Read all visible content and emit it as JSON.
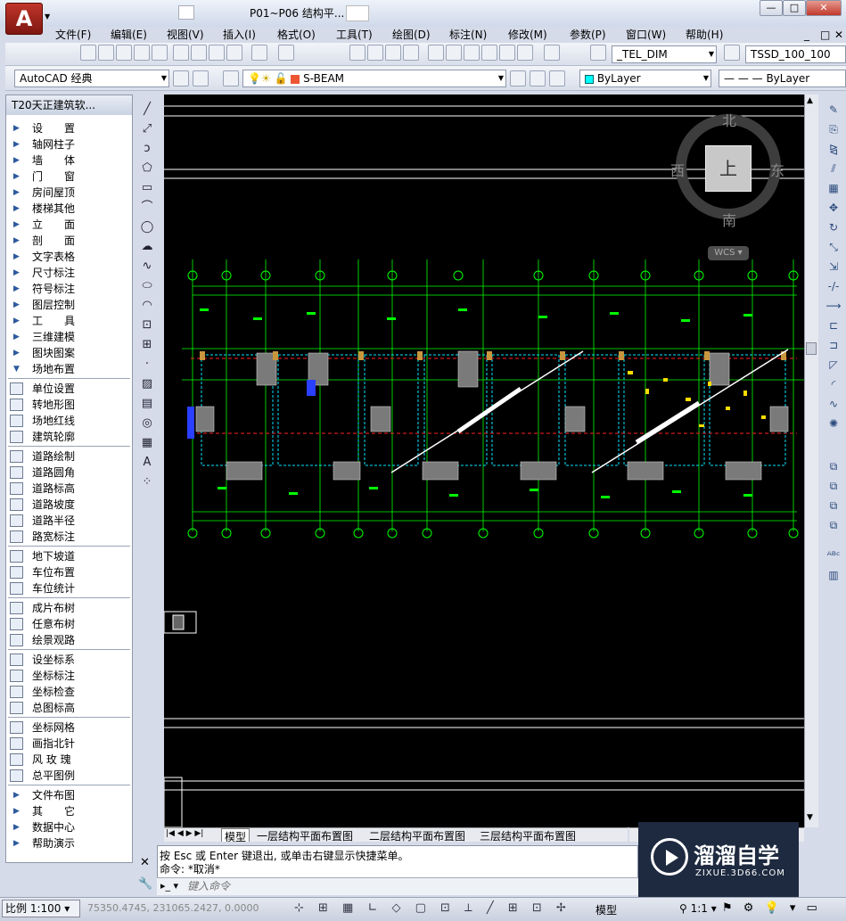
{
  "window": {
    "title": "P01~P06 结构平...",
    "logo_letter": "A",
    "controls": [
      "—",
      "□",
      "✕"
    ]
  },
  "menubar": {
    "items": [
      "文件(F)",
      "编辑(E)",
      "视图(V)",
      "插入(I)",
      "格式(O)",
      "工具(T)",
      "绘图(D)",
      "标注(N)",
      "修改(M)",
      "参数(P)",
      "窗口(W)",
      "帮助(H)"
    ],
    "doc_controls": [
      "_",
      "□",
      "✕"
    ]
  },
  "toolbar1": {
    "dim_style": "_TEL_DIM",
    "table_style": "TSSD_100_100"
  },
  "toolbar2": {
    "workspace": "AutoCAD 经典",
    "layer": "S-BEAM",
    "color": "ByLayer",
    "linetype": "ByLayer"
  },
  "sidebar": {
    "title": "T20天正建筑软...",
    "groups": [
      {
        "kind": "tri",
        "items": [
          "设　　置",
          "轴网柱子",
          "墙　　体",
          "门　　窗",
          "房间屋顶",
          "楼梯其他",
          "立　　面",
          "剖　　面",
          "文字表格",
          "尺寸标注",
          "符号标注",
          "图层控制",
          "工　　具",
          "三维建模",
          "图块图案"
        ]
      },
      {
        "kind": "open",
        "items": [
          "场地布置"
        ]
      },
      {
        "kind": "icon",
        "items": [
          "单位设置",
          "转地形图",
          "场地红线",
          "建筑轮廓"
        ]
      },
      {
        "kind": "icon",
        "items": [
          "道路绘制",
          "道路圆角",
          "道路标高",
          "道路坡度",
          "道路半径",
          "路宽标注"
        ]
      },
      {
        "kind": "icon",
        "items": [
          "地下坡道",
          "车位布置",
          "车位统计"
        ]
      },
      {
        "kind": "icon",
        "items": [
          "成片布树",
          "任意布树",
          "绘景观路"
        ]
      },
      {
        "kind": "icon",
        "items": [
          "设坐标系",
          "坐标标注",
          "坐标检查",
          "总图标高"
        ]
      },
      {
        "kind": "icon",
        "items": [
          "坐标网格",
          "画指北针",
          "风 玫 瑰",
          "总平图例"
        ]
      },
      {
        "kind": "tri",
        "items": [
          "文件布图",
          "其　　它",
          "数据中心",
          "帮助演示"
        ]
      }
    ]
  },
  "viewcube": {
    "north": "北",
    "south": "南",
    "east": "东",
    "west": "西",
    "face": "上",
    "wcs": "WCS"
  },
  "layout_tabs": {
    "active": "模型",
    "tabs": [
      "模型",
      "一层结构平面布置图",
      "二层结构平面布置图",
      "三层结构平面布置图"
    ]
  },
  "command": {
    "line1": "按 Esc 或 Enter 键退出, 或单击右键显示快捷菜单。",
    "line2": "命令: *取消*",
    "placeholder": "键入命令"
  },
  "status": {
    "scale": "比例 1:100",
    "coords": "75350.4745, 231065.2427, 0.0000",
    "model": "模型",
    "annot_scale": "1:1"
  },
  "watermark": {
    "title": "溜溜自学",
    "url": "ZIXUE.3D66.COM"
  },
  "colors": {
    "canvas": "#000000",
    "axis_green": "#00ff00",
    "wall_cyan": "#00ffff",
    "column_orange": "#c8963c",
    "hatch_grey": "#808080",
    "dash_red": "#ff0000"
  }
}
